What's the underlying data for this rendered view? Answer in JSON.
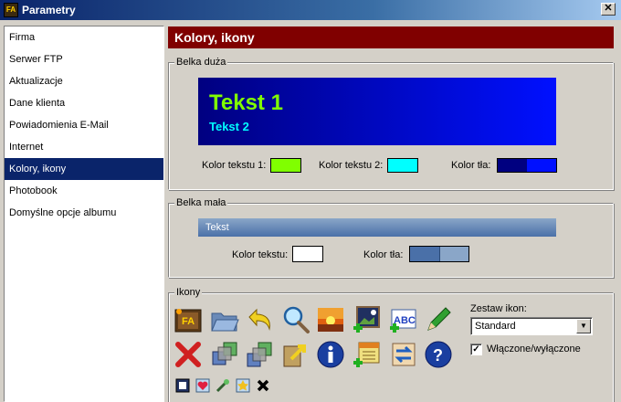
{
  "window": {
    "title": "Parametry",
    "app_icon_text": "FA",
    "close_glyph": "✕"
  },
  "sidebar": {
    "items": [
      {
        "label": "Firma",
        "selected": false
      },
      {
        "label": "Serwer FTP",
        "selected": false
      },
      {
        "label": "Aktualizacje",
        "selected": false
      },
      {
        "label": "Dane klienta",
        "selected": false
      },
      {
        "label": "Powiadomienia E-Mail",
        "selected": false
      },
      {
        "label": "Internet",
        "selected": false
      },
      {
        "label": "Kolory, ikony",
        "selected": true
      },
      {
        "label": "Photobook",
        "selected": false
      },
      {
        "label": "Domyślne opcje albumu",
        "selected": false
      }
    ]
  },
  "section": {
    "title": "Kolory, ikony",
    "header_color": "#800000"
  },
  "big_bar": {
    "legend": "Belka duża",
    "preview_text1": "Tekst 1",
    "preview_text2": "Tekst 2",
    "text1_label": "Kolor tekstu 1:",
    "text1_color": "#80ff00",
    "text2_label": "Kolor tekstu 2:",
    "text2_color": "#00ffff",
    "bg_label": "Kolor tła:",
    "bg_colors": [
      "#000080",
      "#0010ff"
    ]
  },
  "small_bar": {
    "legend": "Belka mała",
    "preview_text": "Tekst",
    "text_label": "Kolor tekstu:",
    "text_color": "#ffffff",
    "bg_label": "Kolor tła:",
    "bg_colors": [
      "#4a70a8",
      "#8aa6c8"
    ]
  },
  "icons": {
    "legend": "Ikony",
    "set_label": "Zestaw ikon:",
    "set_value": "Standard",
    "enabled_label": "Włączone/wyłączone",
    "enabled_checked": true,
    "check_glyph": "✓",
    "dropdown_glyph": "▼",
    "row1": [
      "fa-logo-icon",
      "folder-open-icon",
      "undo-arrow-icon",
      "magnifier-icon",
      "sunset-image-icon",
      "add-image-icon",
      "spellcheck-icon",
      "pencil-icon"
    ],
    "row2": [
      "delete-x-icon",
      "copy-squares-icon",
      "copy-squares-icon",
      "export-arrow-icon",
      "info-icon",
      "add-calendar-icon",
      "swap-arrows-icon",
      "help-icon"
    ],
    "row3": [
      "frame-icon",
      "heart-image-icon",
      "wand-icon",
      "star-image-icon",
      "small-x-icon"
    ]
  }
}
